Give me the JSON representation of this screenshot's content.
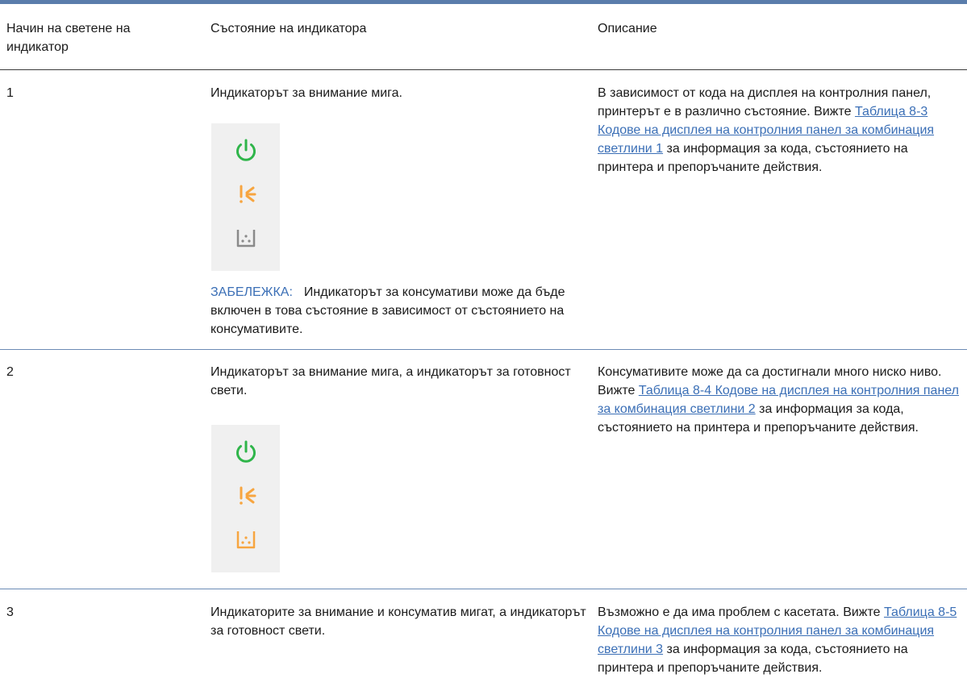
{
  "headers": {
    "col1": "Начин на светене на индикатор",
    "col2": "Състояние на индикатора",
    "col3": "Описание"
  },
  "colors": {
    "ready": "#2fb54a",
    "attention": "#f7a540",
    "supplies_off": "#8a8a8a"
  },
  "icons": [
    "power-icon",
    "attention-icon",
    "supplies-icon"
  ],
  "rows": [
    {
      "number": "1",
      "state": "Индикаторът за внимание мига.",
      "note_label": "ЗАБЕЛЕЖКА:",
      "note_text": "Индикаторът за консумативи може да бъде включен в това състояние в зависимост от състоянието на консумативите.",
      "desc_before": "В зависимост от кода на дисплея на контролния панел, принтерът е в различно състояние. Вижте ",
      "desc_link": "Таблица 8-3 Кодове на дисплея на контролния панел за комбинация светлини 1",
      "desc_after": " за информация за кода, състоянието на принтера и препоръчаните действия."
    },
    {
      "number": "2",
      "state": "Индикаторът за внимание мига, а индикаторът за готовност свети.",
      "desc_before": "Консумативите може да са достигнали много ниско ниво. Вижте ",
      "desc_link": "Таблица 8-4 Кодове на дисплея на контролния панел за комбинация светлини 2",
      "desc_after": " за информация за кода, състоянието на принтера и препоръчаните действия."
    },
    {
      "number": "3",
      "state": "Индикаторите за внимание и консуматив мигат, а индикаторът за готовност свети.",
      "desc_before": "Възможно е да има проблем с касетата. Вижте ",
      "desc_link": "Таблица 8-5 Кодове на дисплея на контролния панел за комбинация светлини 3",
      "desc_after": " за информация за кода, състоянието на принтера и препоръчаните действия."
    }
  ]
}
